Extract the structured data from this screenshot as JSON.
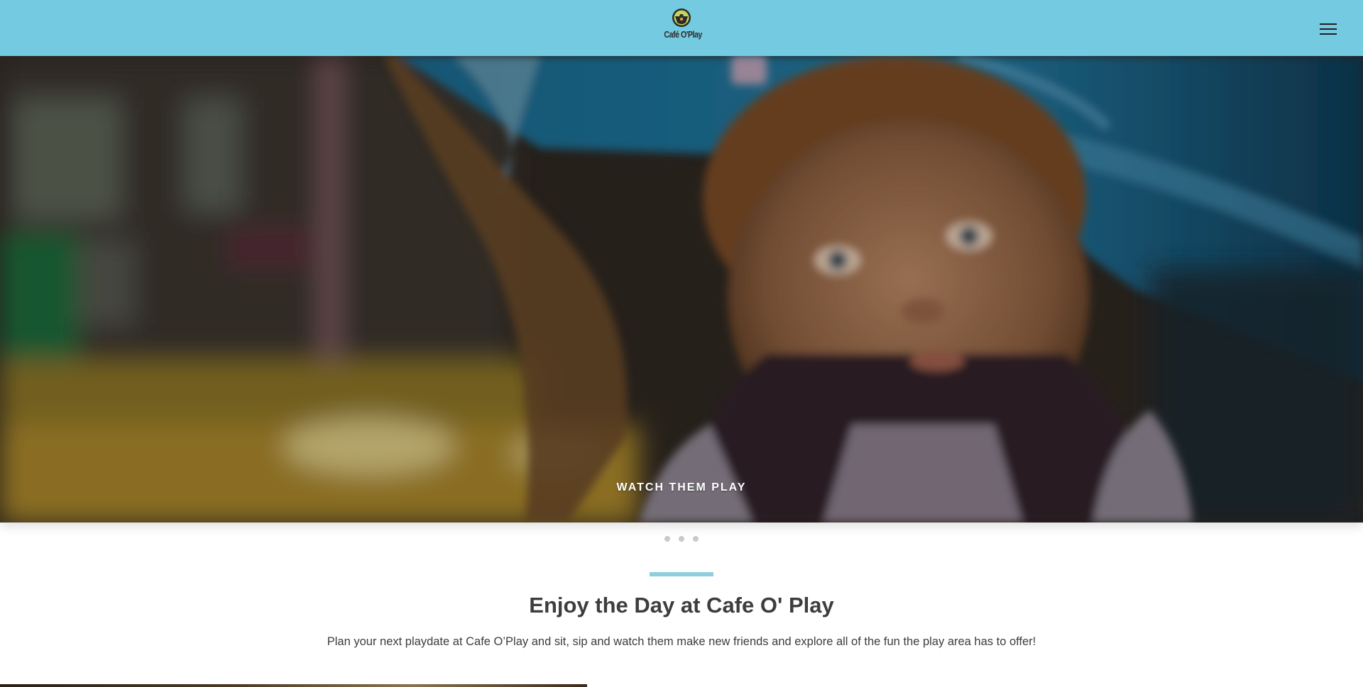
{
  "header": {
    "logo_text": "Café O'Play",
    "menu_icon": "hamburger-menu-icon",
    "background_color": "#74cae0"
  },
  "hero": {
    "image_description_icon": "baby-playground-photo",
    "caption": "WATCH THEM PLAY",
    "slides_count": 3,
    "active_slide": 1
  },
  "intro": {
    "accent_color": "#8fcfdd",
    "title": "Enjoy the Day at Cafe O' Play",
    "text": "Plan your next playdate at Cafe O’Play and sit, sip and watch them make new friends and explore all of the fun the play area has to offer!"
  }
}
